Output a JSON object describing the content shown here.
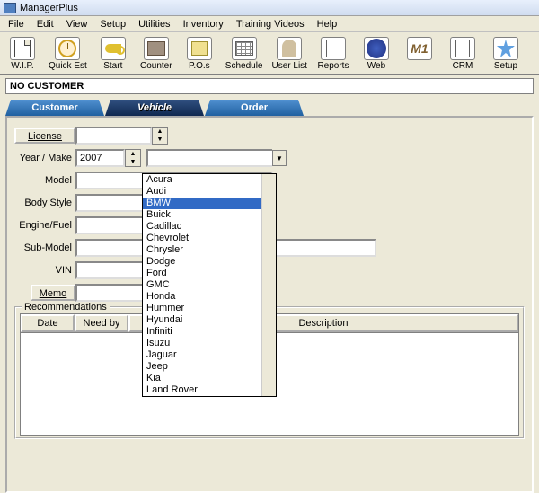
{
  "title": "ManagerPlus",
  "menu": [
    "File",
    "Edit",
    "View",
    "Setup",
    "Utilities",
    "Inventory",
    "Training Videos",
    "Help"
  ],
  "toolbar": [
    {
      "label": "W.I.P.",
      "icon": "page"
    },
    {
      "label": "Quick Est",
      "icon": "clock"
    },
    {
      "label": "Start",
      "icon": "key"
    },
    {
      "label": "Counter",
      "icon": "register"
    },
    {
      "label": "P.O.s",
      "icon": "pos"
    },
    {
      "label": "Schedule",
      "icon": "sched"
    },
    {
      "label": "User List",
      "icon": "user"
    },
    {
      "label": "Reports",
      "icon": "reports"
    },
    {
      "label": "Web",
      "icon": "web"
    },
    {
      "label": "",
      "icon": "m1"
    },
    {
      "label": "CRM",
      "icon": "crm"
    },
    {
      "label": "Setup",
      "icon": "setup"
    }
  ],
  "customer_bar": "NO CUSTOMER",
  "tabs": {
    "customer": "Customer",
    "vehicle": "Vehicle",
    "order": "Order"
  },
  "form": {
    "license": "License",
    "yearmake": "Year / Make",
    "model": "Model",
    "body": "Body Style",
    "engine": "Engine/Fuel",
    "submodel": "Sub-Model",
    "vin": "VIN",
    "memo": "Memo",
    "year_val": "2007"
  },
  "makes": [
    "Acura",
    "Audi",
    "BMW",
    "Buick",
    "Cadillac",
    "Chevrolet",
    "Chrysler",
    "Dodge",
    "Ford",
    "GMC",
    "Honda",
    "Hummer",
    "Hyundai",
    "Infiniti",
    "Isuzu",
    "Jaguar",
    "Jeep",
    "Kia",
    "Land Rover"
  ],
  "selected_make_index": 2,
  "reco": {
    "title": "Recommendations",
    "cols": {
      "date": "Date",
      "needby": "Need by",
      "desc": "Description"
    }
  }
}
